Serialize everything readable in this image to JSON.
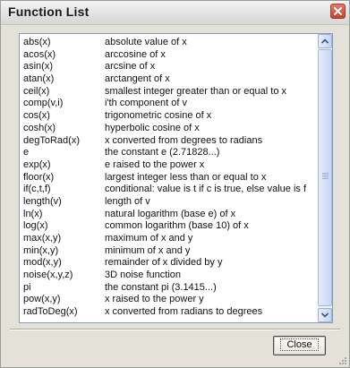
{
  "window": {
    "title": "Function List",
    "close_icon": "close-x-icon"
  },
  "functions": [
    {
      "name": "abs(x)",
      "desc": "absolute value of x"
    },
    {
      "name": "acos(x)",
      "desc": "arccosine of x"
    },
    {
      "name": "asin(x)",
      "desc": "arcsine of x"
    },
    {
      "name": "atan(x)",
      "desc": "arctangent of x"
    },
    {
      "name": "ceil(x)",
      "desc": "smallest integer greater than or equal to x"
    },
    {
      "name": "comp(v,i)",
      "desc": "i'th component of v"
    },
    {
      "name": "cos(x)",
      "desc": "trigonometric cosine of x"
    },
    {
      "name": "cosh(x)",
      "desc": "hyperbolic cosine of x"
    },
    {
      "name": "degToRad(x)",
      "desc": "x converted from degrees to radians"
    },
    {
      "name": "e",
      "desc": "the constant e (2.71828...)"
    },
    {
      "name": "exp(x)",
      "desc": "e raised to the power x"
    },
    {
      "name": "floor(x)",
      "desc": "largest integer less than or equal to x"
    },
    {
      "name": "if(c,t,f)",
      "desc": "conditional: value is t if c is true, else value is f"
    },
    {
      "name": "length(v)",
      "desc": "length of v"
    },
    {
      "name": "ln(x)",
      "desc": "natural logarithm (base e) of x"
    },
    {
      "name": "log(x)",
      "desc": "common logarithm (base 10) of x"
    },
    {
      "name": "max(x,y)",
      "desc": "maximum of x and y"
    },
    {
      "name": "min(x,y)",
      "desc": "minimum of x and y"
    },
    {
      "name": "mod(x,y)",
      "desc": "remainder of x divided by y"
    },
    {
      "name": "noise(x,y,z)",
      "desc": "3D noise function"
    },
    {
      "name": "pi",
      "desc": "the constant pi (3.1415...)"
    },
    {
      "name": "pow(x,y)",
      "desc": "x raised to the power y"
    },
    {
      "name": "radToDeg(x)",
      "desc": "x converted from radians to degrees"
    }
  ],
  "buttons": {
    "close_label": "Close"
  },
  "colors": {
    "dialog_bg": "#e4e1d9",
    "titlebar_close": "#c6412f",
    "scrollbar": "#c9d6f4"
  }
}
